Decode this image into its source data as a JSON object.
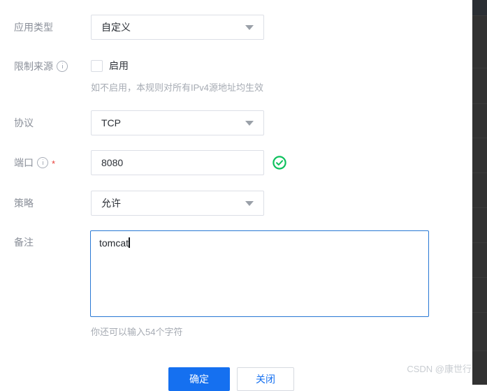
{
  "form": {
    "rows": [
      {
        "label": "应用类型",
        "control": "select",
        "value": "自定义"
      },
      {
        "label": "限制来源",
        "control": "checkbox",
        "checkbox_label": "启用",
        "checked": false,
        "hint": "如不启用，本规则对所有IPv4源地址均生效"
      },
      {
        "label": "协议",
        "control": "select",
        "value": "TCP"
      },
      {
        "label": "端口",
        "control": "input",
        "value": "8080",
        "required": true,
        "valid": true
      },
      {
        "label": "策略",
        "control": "select",
        "value": "允许"
      },
      {
        "label": "备注",
        "control": "textarea",
        "value": "tomcat",
        "hint": "你还可以输入54个字符"
      }
    ]
  },
  "icons": {
    "info": "info-circle-icon",
    "caret": "chevron-down-icon",
    "valid": "check-circle-icon"
  },
  "footer": {
    "confirm_label": "确定",
    "close_label": "关闭"
  },
  "watermark": {
    "text": "CSDN @康世行"
  },
  "colors": {
    "primary": "#1570f0",
    "focus_border": "#2878d4",
    "success": "#0ec15d",
    "required": "#e8403a",
    "label": "#8a8f99",
    "rail": "#323232"
  }
}
